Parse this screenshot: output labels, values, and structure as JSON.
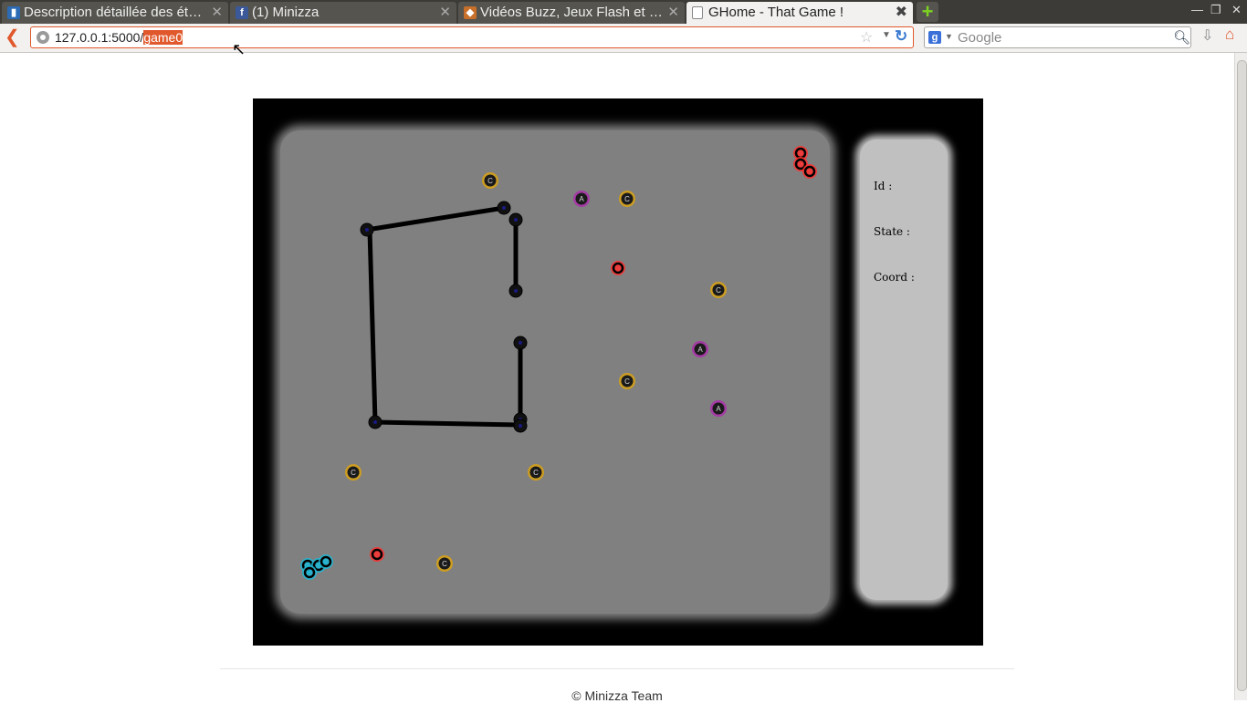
{
  "browser": {
    "tabs": [
      {
        "label": "Description détaillée des ét…",
        "favicon": "trello-icon",
        "active": false
      },
      {
        "label": "(1) Minizza",
        "favicon": "facebook-icon",
        "active": false
      },
      {
        "label": "Vidéos Buzz, Jeux Flash et I…",
        "favicon": "flash-icon",
        "active": false
      },
      {
        "label": "GHome - That Game !",
        "favicon": "blank-page-icon",
        "active": true
      }
    ],
    "url_base": "127.0.0.1:5000/",
    "url_selected": "game0",
    "search_placeholder": "Google"
  },
  "game": {
    "info": {
      "id_label": "Id :",
      "state_label": "State :",
      "coord_label": "Coord :"
    },
    "colors": {
      "c": "#d4a017",
      "a": "#a832a8",
      "red": "#ff3030",
      "cyan": "#1fb8d6"
    },
    "tokens": [
      {
        "kind": "c",
        "label": "C"
      },
      {
        "kind": "c",
        "label": "C"
      },
      {
        "kind": "c",
        "label": "C"
      },
      {
        "kind": "c",
        "label": "C"
      },
      {
        "kind": "c",
        "label": "C"
      },
      {
        "kind": "c",
        "label": "C"
      },
      {
        "kind": "c",
        "label": "C"
      },
      {
        "kind": "a",
        "label": "A"
      },
      {
        "kind": "a",
        "label": "A"
      },
      {
        "kind": "a",
        "label": "A"
      },
      {
        "kind": "red",
        "label": ""
      },
      {
        "kind": "red",
        "label": ""
      },
      {
        "kind": "red",
        "label": ""
      },
      {
        "kind": "red",
        "label": ""
      },
      {
        "kind": "red",
        "label": ""
      },
      {
        "kind": "cyan",
        "label": ""
      },
      {
        "kind": "cyan",
        "label": ""
      },
      {
        "kind": "cyan",
        "label": ""
      },
      {
        "kind": "cyan",
        "label": ""
      }
    ]
  },
  "footer": {
    "text": "© Minizza Team"
  }
}
